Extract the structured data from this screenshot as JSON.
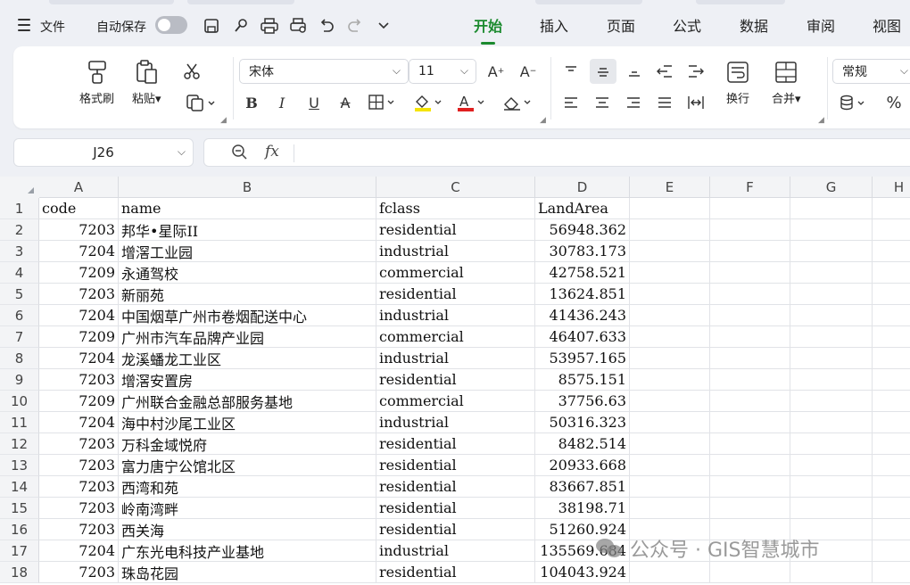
{
  "menubar": {
    "file_label": "文件",
    "autosave_label": "自动保存",
    "tabs": [
      "开始",
      "插入",
      "页面",
      "公式",
      "数据",
      "审阅",
      "视图"
    ],
    "active_tab": "开始"
  },
  "ribbon": {
    "format_painter": "格式刷",
    "paste": "粘贴",
    "paste_caret": "▾",
    "font_name": "宋体",
    "font_size": "11",
    "wrap": "换行",
    "merge": "合并",
    "merge_caret": "▾",
    "number_format": "常规",
    "accent_fill": "#f5e400",
    "accent_font": "#e02020"
  },
  "formula_bar": {
    "name_box": "J26",
    "fx_label": "fx",
    "content": ""
  },
  "sheet": {
    "columns": [
      "A",
      "B",
      "C",
      "D",
      "E",
      "F",
      "G",
      "H"
    ],
    "rows": [
      {
        "n": "1",
        "a": "code",
        "b": "name",
        "c": "fclass",
        "d": "LandArea"
      },
      {
        "n": "2",
        "a": "7203",
        "b": "邦华•星际II",
        "c": "residential",
        "d": "56948.362"
      },
      {
        "n": "3",
        "a": "7204",
        "b": "增滘工业园",
        "c": "industrial",
        "d": "30783.173"
      },
      {
        "n": "4",
        "a": "7209",
        "b": "永通驾校",
        "c": "commercial",
        "d": "42758.521"
      },
      {
        "n": "5",
        "a": "7203",
        "b": "新丽苑",
        "c": "residential",
        "d": "13624.851"
      },
      {
        "n": "6",
        "a": "7204",
        "b": "中国烟草广州市卷烟配送中心",
        "c": "industrial",
        "d": "41436.243"
      },
      {
        "n": "7",
        "a": "7209",
        "b": "广州市汽车品牌产业园",
        "c": "commercial",
        "d": "46407.633"
      },
      {
        "n": "8",
        "a": "7204",
        "b": "龙溪蟠龙工业区",
        "c": "industrial",
        "d": "53957.165"
      },
      {
        "n": "9",
        "a": "7203",
        "b": "增滘安置房",
        "c": "residential",
        "d": "8575.151"
      },
      {
        "n": "10",
        "a": "7209",
        "b": "广州联合金融总部服务基地",
        "c": "commercial",
        "d": "37756.63"
      },
      {
        "n": "11",
        "a": "7204",
        "b": "海中村沙尾工业区",
        "c": "industrial",
        "d": "50316.323"
      },
      {
        "n": "12",
        "a": "7203",
        "b": "万科金域悦府",
        "c": "residential",
        "d": "8482.514"
      },
      {
        "n": "13",
        "a": "7203",
        "b": "富力唐宁公馆北区",
        "c": "residential",
        "d": "20933.668"
      },
      {
        "n": "14",
        "a": "7203",
        "b": "西湾和苑",
        "c": "residential",
        "d": "83667.851"
      },
      {
        "n": "15",
        "a": "7203",
        "b": "岭南湾畔",
        "c": "residential",
        "d": "38198.71"
      },
      {
        "n": "16",
        "a": "7203",
        "b": "西关海",
        "c": "residential",
        "d": "51260.924"
      },
      {
        "n": "17",
        "a": "7204",
        "b": "广东光电科技产业基地",
        "c": "industrial",
        "d": "135569.684"
      },
      {
        "n": "18",
        "a": "7203",
        "b": "珠岛花园",
        "c": "residential",
        "d": "104043.924"
      }
    ]
  },
  "watermark": "公众号 · GIS智慧城市"
}
